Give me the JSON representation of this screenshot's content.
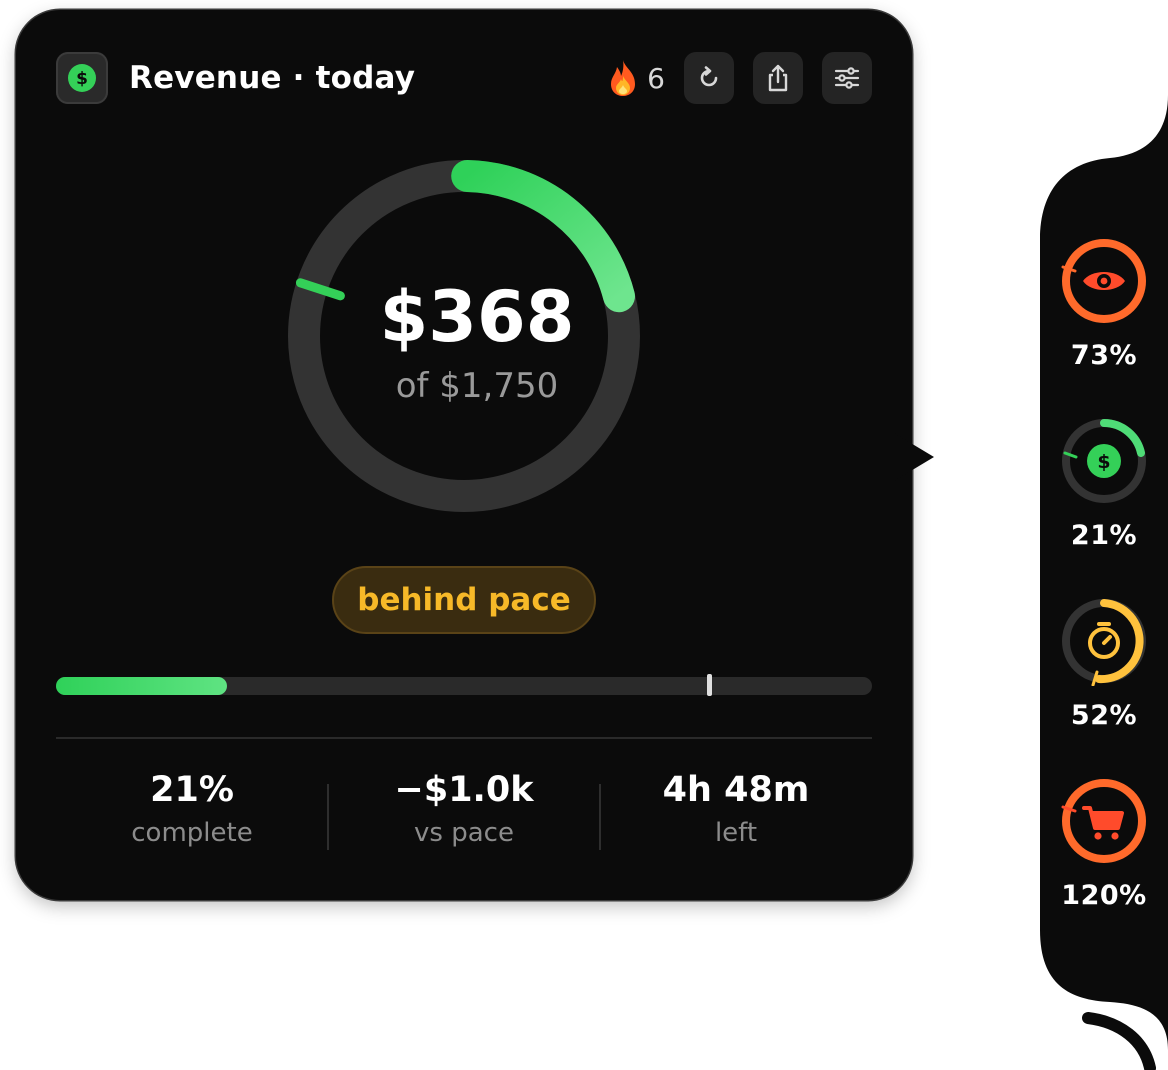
{
  "widget": {
    "title": "Revenue · today",
    "app_icon": "dollar-icon",
    "streak": {
      "icon": "fire-icon",
      "count": "6"
    },
    "buttons": [
      "refresh-icon",
      "share-icon",
      "sliders-icon"
    ]
  },
  "progress": {
    "amount": "$368",
    "goal": "of $1,750",
    "fraction": 0.21,
    "pace_fraction": 0.8,
    "status": "behind pace"
  },
  "stats": [
    {
      "value": "21%",
      "label": "complete"
    },
    {
      "value": "−$1.0k",
      "label": "vs pace"
    },
    {
      "value": "4h 48m",
      "label": "left"
    }
  ],
  "sidebar": {
    "items": [
      {
        "icon": "eye-icon",
        "percent": "73%",
        "fraction": 1.0,
        "color": "#ff6a2b"
      },
      {
        "icon": "dollar-icon",
        "percent": "21%",
        "fraction": 0.21,
        "color": "#34d058"
      },
      {
        "icon": "timer-icon",
        "percent": "52%",
        "fraction": 0.52,
        "color": "#ffc23d"
      },
      {
        "icon": "cart-icon",
        "percent": "120%",
        "fraction": 1.0,
        "color": "#ff5a2b"
      }
    ]
  },
  "colors": {
    "accent_green": "#34d058",
    "status_yellow": "#f7b928",
    "card_bg": "#0b0b0b",
    "track": "#333333"
  }
}
